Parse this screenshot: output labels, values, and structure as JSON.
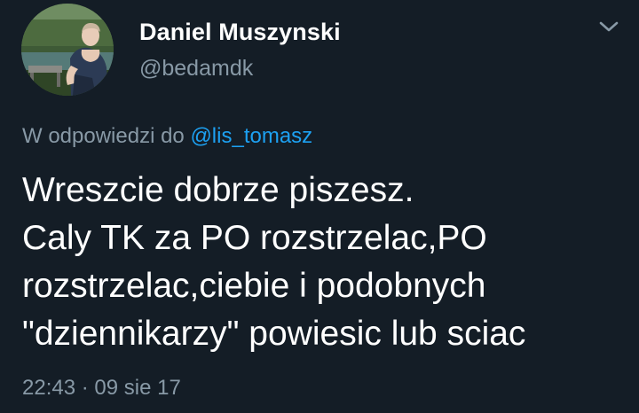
{
  "user": {
    "display_name": "Daniel Muszynski",
    "handle": "@bedamdk"
  },
  "reply": {
    "prefix": "W odpowiedzi do",
    "mention": "@lis_tomasz"
  },
  "tweet": {
    "lines": [
      "Wreszcie dobrze piszesz.",
      "Caly TK za PO rozstrzelac,PO",
      "rozstrzelac,ciebie i podobnych",
      "\"dziennikarzy\" powiesic lub sciac"
    ]
  },
  "meta": {
    "time": "22:43",
    "separator": "·",
    "date": "09 sie 17"
  },
  "colors": {
    "background": "#141d26",
    "text": "#ffffff",
    "secondary": "#8899a6",
    "link": "#1da1f2"
  },
  "icons": {
    "menu": "chevron-down-icon"
  }
}
